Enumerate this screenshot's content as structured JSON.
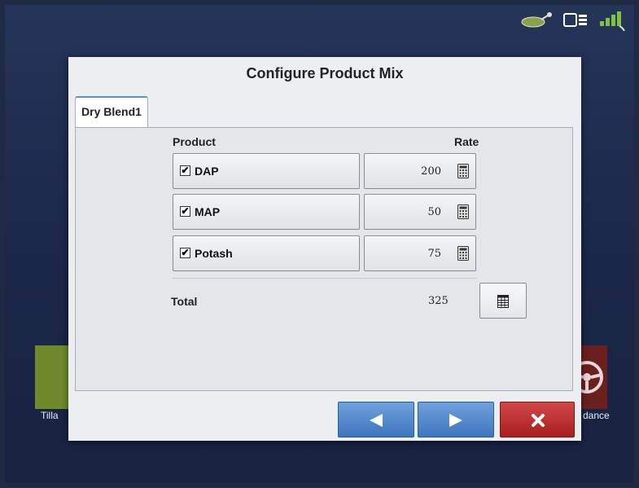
{
  "status_icons": [
    "gps-antenna-icon",
    "display-config-icon",
    "wireless-signal-icon"
  ],
  "background": {
    "left_tile_label": "Tilla",
    "right_tile_label": "dance"
  },
  "dialog": {
    "title": "Configure Product Mix",
    "tab_label": "Dry Blend1",
    "columns": {
      "product": "Product",
      "rate": "Rate"
    },
    "products": [
      {
        "name": "DAP",
        "checked": true,
        "rate": "200"
      },
      {
        "name": "MAP",
        "checked": true,
        "rate": "50"
      },
      {
        "name": "Potash",
        "checked": true,
        "rate": "75"
      }
    ],
    "total_label": "Total",
    "total_value": "325",
    "checkmark": "✔"
  },
  "buttons": {
    "previous_icon": "left-arrow-icon",
    "next_icon": "right-arrow-icon",
    "cancel_icon": "close-icon"
  },
  "colors": {
    "accent_blue": "#3e75bd",
    "cancel_red": "#a91f1f",
    "tab_highlight": "#5b8fd1"
  }
}
